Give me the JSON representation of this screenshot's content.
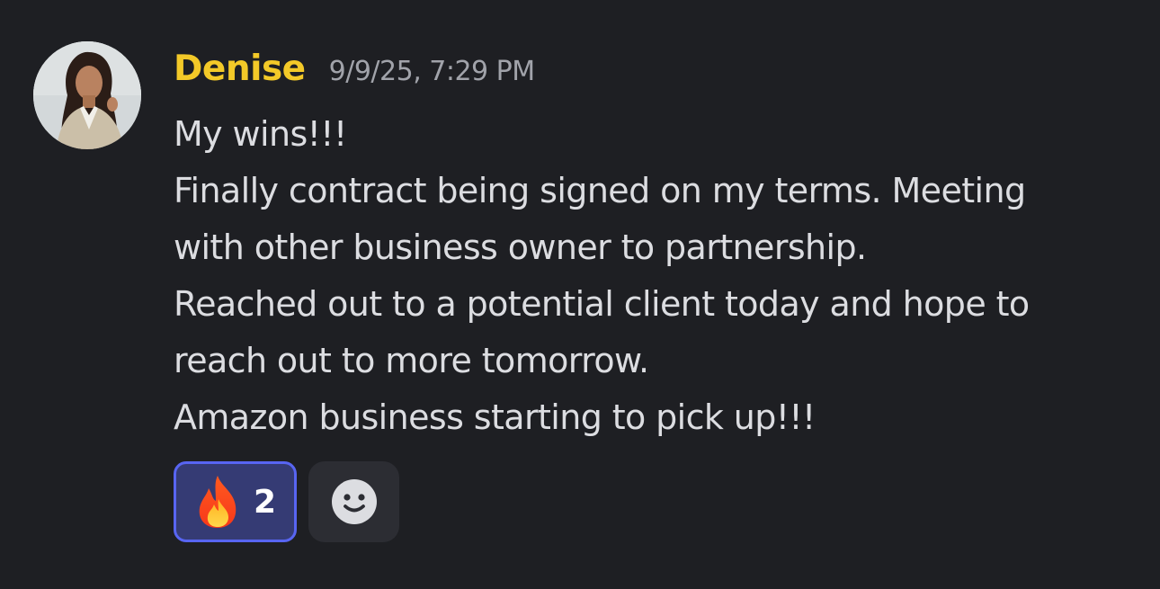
{
  "message": {
    "author": "Denise",
    "timestamp": "9/9/25, 7:29 PM",
    "lines": [
      "My wins!!!",
      "Finally contract being signed on my terms. Meeting",
      "with other business owner to partnership.",
      "Reached out to a potential client today and hope to",
      "reach out to more tomorrow.",
      "Amazon business starting to pick up!!!"
    ]
  },
  "reactions": [
    {
      "emoji": "fire-icon",
      "count": "2",
      "selected": true
    }
  ],
  "add_reaction": {
    "icon": "smiley-face-icon"
  },
  "colors": {
    "background": "#1e1f23",
    "author": "#f3c928",
    "timestamp": "#a1a3aa",
    "text": "#dcdde1",
    "reaction_bg": "#353b74",
    "reaction_border": "#5865f2"
  }
}
